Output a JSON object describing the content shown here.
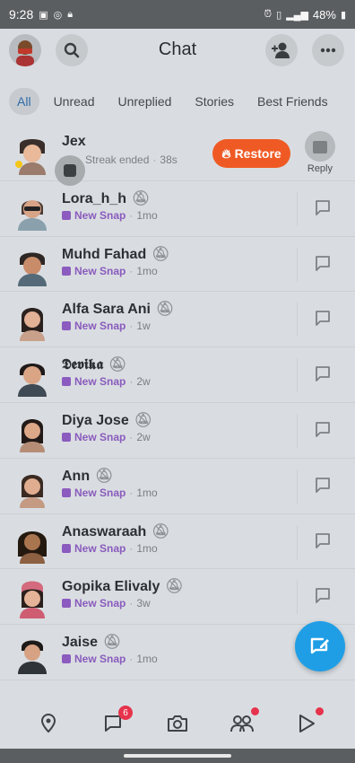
{
  "status_bar": {
    "time": "9:28",
    "battery": "48%"
  },
  "header": {
    "title": "Chat"
  },
  "filters": [
    "All",
    "Unread",
    "Unreplied",
    "Stories",
    "Best Friends"
  ],
  "chats": [
    {
      "name": "Jex",
      "status": "Streak ended",
      "time": "38s",
      "restore_label": "Restore",
      "reply_label": "Reply"
    },
    {
      "name": "Lora_h_h",
      "status": "New Snap",
      "time": "1mo"
    },
    {
      "name": "Muhd Fahad",
      "status": "New Snap",
      "time": "1mo"
    },
    {
      "name": "Alfa Sara Ani",
      "status": "New Snap",
      "time": "1w"
    },
    {
      "name": "𝕯𝖊𝖛𝖎𝖐𝖆",
      "status": "New Snap",
      "time": "2w"
    },
    {
      "name": "Diya Jose",
      "status": "New Snap",
      "time": "2w"
    },
    {
      "name": "Ann",
      "status": "New Snap",
      "time": "1mo"
    },
    {
      "name": "Anaswaraah",
      "status": "New Snap",
      "time": "1mo"
    },
    {
      "name": "Gopika Elivaly",
      "status": "New Snap",
      "time": "3w"
    },
    {
      "name": "Jaise",
      "status": "New Snap",
      "time": "1mo"
    }
  ],
  "bottom_nav": {
    "chat_badge": "6"
  },
  "colors": {
    "accent": "#1f9ee6",
    "restore": "#ef5a24",
    "new_snap": "#8c5bbf",
    "badge": "#e6334c"
  }
}
